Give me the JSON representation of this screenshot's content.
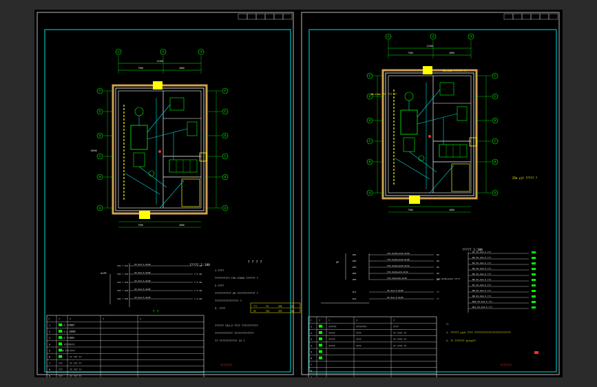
{
  "colors": {
    "background": "#000000",
    "viewport_frame": "#2b2b2b",
    "sheet_border": "#00e0e0",
    "dimension": "#00ff00",
    "wall": "#ffffff",
    "wall_hatch": "#d0a050",
    "equipment": "#00ff00",
    "cable": "#00e0e0",
    "highlight": "#ffff00",
    "marker": "#ff3030",
    "text": "#e8e8e8"
  },
  "left_sheet": {
    "grid_top": [
      "①",
      "②",
      "③"
    ],
    "grid_side": [
      "Ⓕ",
      "Ⓔ",
      "Ⓓ",
      "Ⓒ",
      "Ⓑ",
      "Ⓐ"
    ],
    "dim_top": [
      "7500",
      "4800"
    ],
    "dim_total": "12300",
    "dim_left": "18900",
    "dim_bottom": [
      "7500",
      "4800"
    ],
    "plan_caption": "?????  1:100",
    "notes_title": "?  ?  ?  ?",
    "note_lines": [
      "1.????",
      "  ??????????    YJV-YJV22 ??????  ?",
      "2.????",
      "  ???????????   VV   ????????????  ?",
      "  ????????????????  ?",
      "3. ????",
      "  ??????  YJV-2 ???? ???????????",
      "  ????????????  ?????????????",
      "  ?? ???????????? 13  ?"
    ],
    "note_table": {
      "header": [
        "???",
        "7H",
        "2SK",
        "2SL"
      ],
      "row": [
        "5K",
        "2S5",
        "2S4",
        "2S5"
      ]
    },
    "panel_label": "ALPB",
    "schedule_rows": [
      {
        "item": "1X1 ? 1X1",
        "cable": "VV-4x2.5-SC20",
        "load": "7.5 kW"
      },
      {
        "item": "1X2 ? 1X2",
        "cable": "VV-4x2.5-SC20",
        "load": "7.5 kW"
      },
      {
        "item": "1X3 ? 1X3",
        "cable": "VV-4x2.5-SC20",
        "load": "7.5 kW"
      },
      {
        "item": "1X4 ? 1X4",
        "cable": "VV-4x2.5-SC20",
        "load": "7.5 kW"
      },
      {
        "item": "1X5 ? 1X5",
        "cable": "VV-4x2.5-SC20",
        "load": "7.5 kW"
      }
    ],
    "legend_title": "?  ?",
    "legend_headers": [
      "?",
      "?",
      "?",
      "?",
      "?"
    ],
    "legend_rows": [
      {
        "no": "1",
        "name": "DCD-C  ?????",
        "qty": "????"
      },
      {
        "no": "2",
        "name": "DCD-C-L  ?????",
        "qty": "????"
      },
      {
        "no": "3",
        "name": "DCD-C  ?????",
        "qty": "????"
      },
      {
        "no": "4",
        "name": "LCS  ?????",
        "qty": "????"
      },
      {
        "no": "5",
        "name": "?YJV  ???",
        "qty": "????"
      },
      {
        "no": "6",
        "name": "???",
        "qty": "?? ???   ??"
      },
      {
        "no": "7",
        "name": "???",
        "qty": "?? ???   ??"
      },
      {
        "no": "8",
        "name": "???",
        "qty": "?? ???   ??"
      },
      {
        "no": "9",
        "name": "???",
        "qty": "?? ???   ??"
      }
    ],
    "title_block": "???????"
  },
  "right_sheet": {
    "grid_top": [
      "①",
      "②",
      "③"
    ],
    "grid_side": [
      "Ⓕ",
      "Ⓔ",
      "Ⓓ",
      "Ⓒ",
      "Ⓑ",
      "Ⓐ"
    ],
    "dim_top": [
      "7500",
      "4800"
    ],
    "dim_total": "12300",
    "cable_note_top": "4RLx1mm ?????? ??",
    "cable_note_left": "4RLx1mm ??? ??? ??",
    "cable_note_right": "25m  yjt  ????? ?",
    "plan_caption": "?????  1:100",
    "panel_label": "AP",
    "schedule_rows": [
      {
        "item": "WP1",
        "cable": "YJV-4x35+1x16-SC50",
        "load": "kW"
      },
      {
        "item": "WP2",
        "cable": "YJV-4x25+1x16-SC40",
        "load": "kW"
      },
      {
        "item": "WP3",
        "cable": "YJV-4x16+1x10-SC32",
        "load": "kW"
      },
      {
        "item": "WP4",
        "cable": "YJV-4x10+1x6-SC32",
        "load": "kW"
      },
      {
        "item": "WP5",
        "cable": "YJV-4x6+1x6-SC25",
        "load": "kW"
      }
    ],
    "sub_schedule": [
      {
        "item": "WL1",
        "cable": "VV-3x2.5-SC20",
        "load": "??"
      },
      {
        "item": "WL2",
        "cable": "VV-3x2.5-SC20",
        "load": "??"
      }
    ],
    "feeder_label": "YJV-4x35+1x16 ?????",
    "branch_rows": [
      "N1  VV-3x2.5  ???",
      "N2  VV-3x2.5  ???",
      "N3  VV-3x2.5  ???",
      "N4  VV-3x2.5  ???",
      "N5  VV-3x2.5  ???",
      "N6  VV-3x2.5  ???",
      "N7  VV-3x2.5  ???",
      "N8  VV-3x2.5  ???",
      "N9  VV-3x2.5  ???",
      "N10  VV-3x2.5  ???",
      "N11  VV-3x2.5  ???"
    ],
    "legend_headers": [
      "?",
      "?",
      "?",
      "?",
      "?"
    ],
    "legend_rows": [
      {
        "no": "1",
        "code": "ABG",
        "name": "??????",
        "spec": "????????",
        "qty": "????"
      },
      {
        "no": "2",
        "code": "AD",
        "name": "?????",
        "spec": "????",
        "qty": "?? ???? ??"
      },
      {
        "no": "3",
        "code": "AL",
        "name": "?????",
        "spec": "????",
        "qty": "?? ???? ??"
      },
      {
        "no": "4",
        "code": "AP",
        "name": "?????",
        "spec": "????",
        "qty": "?? ???? ??"
      },
      {
        "no": "5",
        "code": "",
        "name": "",
        "spec": "",
        "qty": ""
      },
      {
        "no": "6",
        "code": "",
        "name": "",
        "spec": "",
        "qty": ""
      },
      {
        "no": "7",
        "code": "",
        "name": "",
        "spec": "",
        "qty": ""
      },
      {
        "no": "8",
        "code": "",
        "name": "",
        "spec": "",
        "qty": ""
      },
      {
        "no": "9",
        "code": "",
        "name": "",
        "spec": "",
        "qty": ""
      }
    ],
    "notes_heading": "?:",
    "note_lines": [
      "1. ?????? yjvt ???? ??????????????????????????",
      "2. ?? ??????? yjtvy??"
    ],
    "title_block": "???????"
  }
}
